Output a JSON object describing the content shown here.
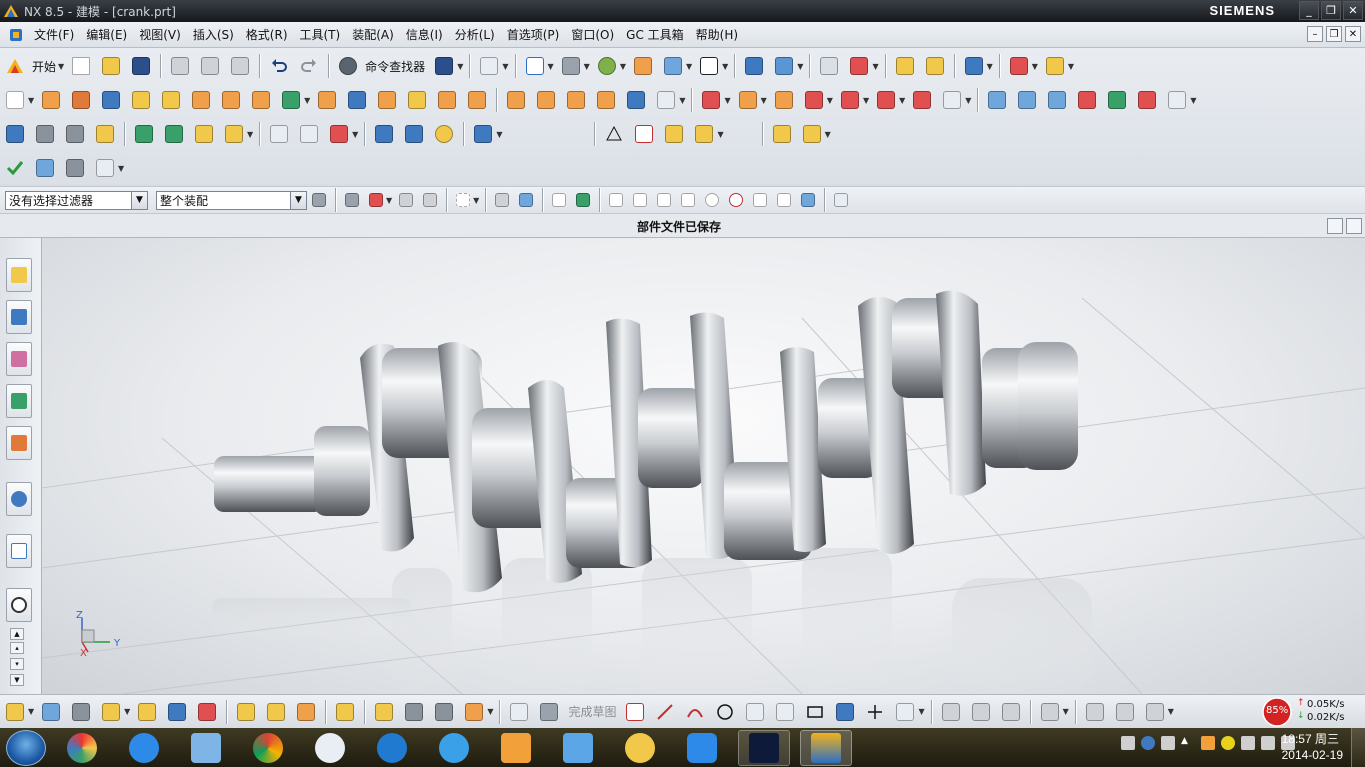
{
  "window": {
    "title": "NX 8.5 - 建模 - [crank.prt]",
    "brand": "SIEMENS",
    "controls": [
      "_",
      "❐",
      "✕"
    ]
  },
  "menu": {
    "items": [
      "文件(F)",
      "编辑(E)",
      "视图(V)",
      "插入(S)",
      "格式(R)",
      "工具(T)",
      "装配(A)",
      "信息(I)",
      "分析(L)",
      "首选项(P)",
      "窗口(O)",
      "GC 工具箱",
      "帮助(H)"
    ],
    "doc_controls": [
      "–",
      "❐",
      "✕"
    ]
  },
  "toolbar": {
    "start_label": "开始",
    "command_finder_label": "命令查找器"
  },
  "filter": {
    "selection_filter": "没有选择过滤器",
    "scope": "整个装配"
  },
  "status": {
    "message": "部件文件已保存"
  },
  "triad": {
    "z": "Z",
    "y": "Y",
    "x": "X"
  },
  "sketch": {
    "finish_label": "完成草图"
  },
  "network": {
    "percent": "85%",
    "up": "0.05K/s",
    "down": "0.02K/s"
  },
  "taskbar": {
    "time": "18:57 周三",
    "date": "2014-02-19"
  },
  "colors": {
    "accent": "#1e5aa6",
    "title_bg": "#15181c",
    "viewport_bg": "#e9ebee",
    "gauge_red": "#d32222"
  }
}
